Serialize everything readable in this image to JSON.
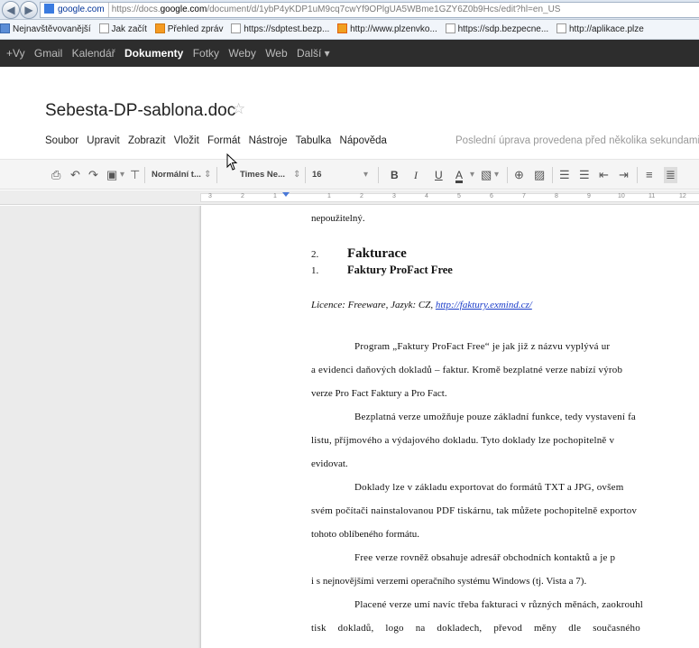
{
  "browser": {
    "site_name": "google.com",
    "url_prefix": "https://docs.",
    "url_host": "google.com",
    "url_path": "/document/d/1ybP4yKDP1uM9cq7cwYf9OPlgUA5WBme1GZY6Z0b9Hcs/edit?hl=en_US"
  },
  "favorites": [
    {
      "label": "Nejnavštěvovanější",
      "icon": "star-folder-icon"
    },
    {
      "label": "Jak začít",
      "icon": "page-icon"
    },
    {
      "label": "Přehled zpráv",
      "icon": "rss-icon"
    },
    {
      "label": "https://sdptest.bezp...",
      "icon": "page-icon"
    },
    {
      "label": "http://www.plzenvko...",
      "icon": "plzen-icon"
    },
    {
      "label": "https://sdp.bezpecne...",
      "icon": "page-icon"
    },
    {
      "label": "http://aplikace.plze",
      "icon": "page-icon"
    }
  ],
  "google_bar": [
    "+Vy",
    "Gmail",
    "Kalendář",
    "Dokumenty",
    "Fotky",
    "Weby",
    "Web",
    "Další ▾"
  ],
  "google_bar_active": "Dokumenty",
  "document": {
    "title": "Sebesta-DP-sablona.doc",
    "last_edit": "Poslední úprava provedena před několika sekundami"
  },
  "menu": [
    "Soubor",
    "Upravit",
    "Zobrazit",
    "Vložit",
    "Formát",
    "Nástroje",
    "Tabulka",
    "Nápověda"
  ],
  "toolbar": {
    "style": "Normální t...",
    "font": "Times Ne...",
    "size": "16",
    "bold": "B",
    "italic": "I",
    "underline": "U",
    "text_color": "A"
  },
  "ruler_numbers": [
    "3",
    "2",
    "1",
    "1",
    "1",
    "2",
    "3",
    "4",
    "5",
    "6",
    "7",
    "8",
    "9",
    "10",
    "11",
    "12"
  ],
  "content": {
    "top_line": "nepoužitelný.",
    "h1_num": "2.",
    "h1_text": "Fakturace",
    "h2_num": "1.",
    "h2_text": "Faktury ProFact Free",
    "licence_prefix": "Licence: Freeware, Jazyk: CZ, ",
    "licence_link": "http://faktury.exmind.cz/",
    "p1_l1": "Program „Faktury ProFact Free“ je jak již z názvu vyplývá ur",
    "p1_l2": "a evidenci daňových dokladů – faktur. Kromě bezplatné verze nabízí výrob",
    "p1_l3": "verze Pro Fact Faktury a Pro Fact.",
    "p2_l1": "Bezplatná verze umožňuje pouze základní funkce, tedy vystavení fa",
    "p2_l2": "listu, příjmového a výdajového dokladu. Tyto doklady lze pochopitelně v",
    "p2_l3": "evidovat.",
    "p3_l1": "Doklady lze v základu exportovat do formátů TXT a JPG, ovšem",
    "p3_l2": "svém počítači nainstalovanou PDF tiskárnu, tak můžete pochopitelně exportov",
    "p3_l3": "tohoto oblíbeného formátu.",
    "p4_l1": "Free verze rovněž obsahuje adresář obchodních kontaktů a je p",
    "p4_l2": "i s nejnovějšími verzemi operačního systému Windows (tj. Vista a 7).",
    "p5_l1": "Placené verze umí navíc třeba fakturaci v různých měnách, zaokrouhl",
    "p5_l2": "tisk dokladů, logo na dokladech, převod měny dle současného"
  },
  "colors": {
    "gbar_bg": "#2d2d2d",
    "link": "#1a3cc9",
    "accent_blue": "#4a79d8"
  }
}
